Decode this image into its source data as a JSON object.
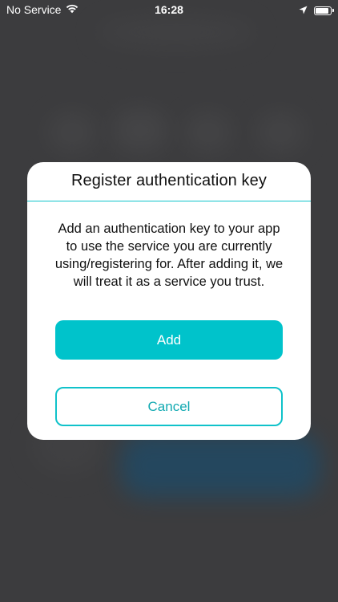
{
  "status_bar": {
    "carrier": "No Service",
    "time": "16:28",
    "icons": [
      "wifi-icon",
      "location-arrow-icon",
      "battery-icon"
    ]
  },
  "dialog": {
    "title": "Register authentication key",
    "message": "Add an authentication key to your app to use the service you are currently using/registering for. After adding it, we will treat it as a service you trust.",
    "add_label": "Add",
    "cancel_label": "Cancel"
  },
  "colors": {
    "accent": "#00c3cb",
    "overlay_background": "#3c3c3e",
    "dialog_background": "#ffffff",
    "text": "#111111"
  }
}
